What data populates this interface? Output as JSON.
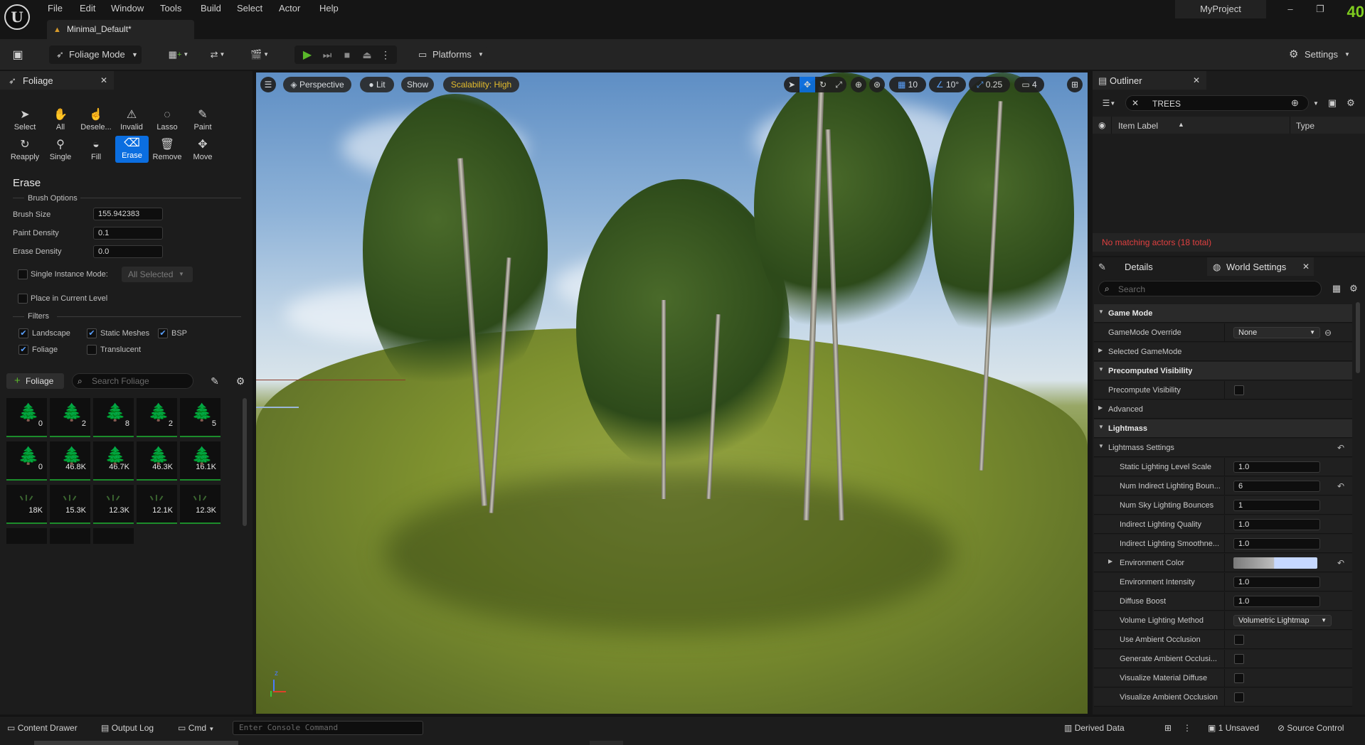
{
  "menu": [
    "File",
    "Edit",
    "Window",
    "Tools",
    "Build",
    "Select",
    "Actor",
    "Help"
  ],
  "document_tab": "Minimal_Default*",
  "project_name": "MyProject",
  "fps": "40",
  "toolbar": {
    "mode": "Foliage Mode",
    "platforms": "Platforms",
    "settings": "Settings"
  },
  "foliage": {
    "tab_title": "Foliage",
    "tools_row1": [
      "Select",
      "All",
      "Desele...",
      "Invalid",
      "Lasso",
      "Paint"
    ],
    "tools_row2": [
      "Reapply",
      "Single",
      "Fill",
      "Erase",
      "Remove",
      "Move"
    ],
    "active_tool": "Erase",
    "section_title": "Erase",
    "brush_options_title": "Brush Options",
    "brush_size_label": "Brush Size",
    "brush_size_value": "155.942383",
    "paint_density_label": "Paint Density",
    "paint_density_value": "0.1",
    "erase_density_label": "Erase Density",
    "erase_density_value": "0.0",
    "single_instance_label": "Single Instance Mode:",
    "single_instance_value": "All Selected",
    "place_current_label": "Place in Current Level",
    "filters_title": "Filters",
    "filters": [
      {
        "label": "Landscape",
        "checked": true
      },
      {
        "label": "Static Meshes",
        "checked": true
      },
      {
        "label": "BSP",
        "checked": true
      },
      {
        "label": "Foliage",
        "checked": true
      },
      {
        "label": "Translucent",
        "checked": false
      }
    ],
    "add_button": "Foliage",
    "search_placeholder": "Search Foliage",
    "thumb_counts": [
      "0",
      "2",
      "8",
      "2",
      "5",
      "0",
      "46.8K",
      "46.7K",
      "46.3K",
      "16.1K",
      "18K",
      "15.3K",
      "12.3K",
      "12.1K",
      "12.3K"
    ]
  },
  "viewport": {
    "perspective": "Perspective",
    "lit": "Lit",
    "show": "Show",
    "scalability": "Scalability: High",
    "grid_snap": "10",
    "rot_snap": "10°",
    "scale_snap": "0.25",
    "camera_speed": "4"
  },
  "outliner": {
    "title": "Outliner",
    "search_value": "TREES",
    "col_label": "Item Label",
    "col_type": "Type",
    "message": "No matching actors (18 total)"
  },
  "details": {
    "tab_details": "Details",
    "tab_world": "World Settings",
    "search_placeholder": "Search",
    "rows": [
      {
        "name": "Game Mode",
        "kind": "cat",
        "indent": 0
      },
      {
        "name": "GameMode Override",
        "kind": "select",
        "value": "None",
        "indent": 1
      },
      {
        "name": "Selected GameMode",
        "kind": "collapsed",
        "indent": 0
      },
      {
        "name": "Precomputed Visibility",
        "kind": "cat",
        "indent": 0
      },
      {
        "name": "Precompute Visibility",
        "kind": "check",
        "indent": 1
      },
      {
        "name": "Advanced",
        "kind": "collapsed",
        "indent": 0
      },
      {
        "name": "Lightmass",
        "kind": "cat",
        "indent": 0
      },
      {
        "name": "Lightmass Settings",
        "kind": "group",
        "indent": 0
      },
      {
        "name": "Static Lighting Level Scale",
        "kind": "num",
        "value": "1.0",
        "indent": 2
      },
      {
        "name": "Num Indirect Lighting Boun...",
        "kind": "num",
        "value": "6",
        "indent": 2
      },
      {
        "name": "Num Sky Lighting Bounces",
        "kind": "num",
        "value": "1",
        "indent": 2
      },
      {
        "name": "Indirect Lighting Quality",
        "kind": "num",
        "value": "1.0",
        "indent": 2
      },
      {
        "name": "Indirect Lighting Smoothne...",
        "kind": "num",
        "value": "1.0",
        "indent": 2
      },
      {
        "name": "Environment Color",
        "kind": "color",
        "indent": 2
      },
      {
        "name": "Environment Intensity",
        "kind": "num",
        "value": "1.0",
        "indent": 2
      },
      {
        "name": "Diffuse Boost",
        "kind": "num",
        "value": "1.0",
        "indent": 2
      },
      {
        "name": "Volume Lighting Method",
        "kind": "select",
        "value": "Volumetric Lightmap",
        "indent": 2
      },
      {
        "name": "Use Ambient Occlusion",
        "kind": "check",
        "indent": 2
      },
      {
        "name": "Generate Ambient Occlusi...",
        "kind": "check",
        "indent": 2
      },
      {
        "name": "Visualize Material Diffuse",
        "kind": "check",
        "indent": 2
      },
      {
        "name": "Visualize Ambient Occlusion",
        "kind": "check",
        "indent": 2
      }
    ]
  },
  "statusbar": {
    "content_drawer": "Content Drawer",
    "output_log": "Output Log",
    "cmd": "Cmd",
    "console_placeholder": "Enter Console Command",
    "derived_data": "Derived Data",
    "unsaved": "1 Unsaved",
    "source_control": "Source Control"
  }
}
